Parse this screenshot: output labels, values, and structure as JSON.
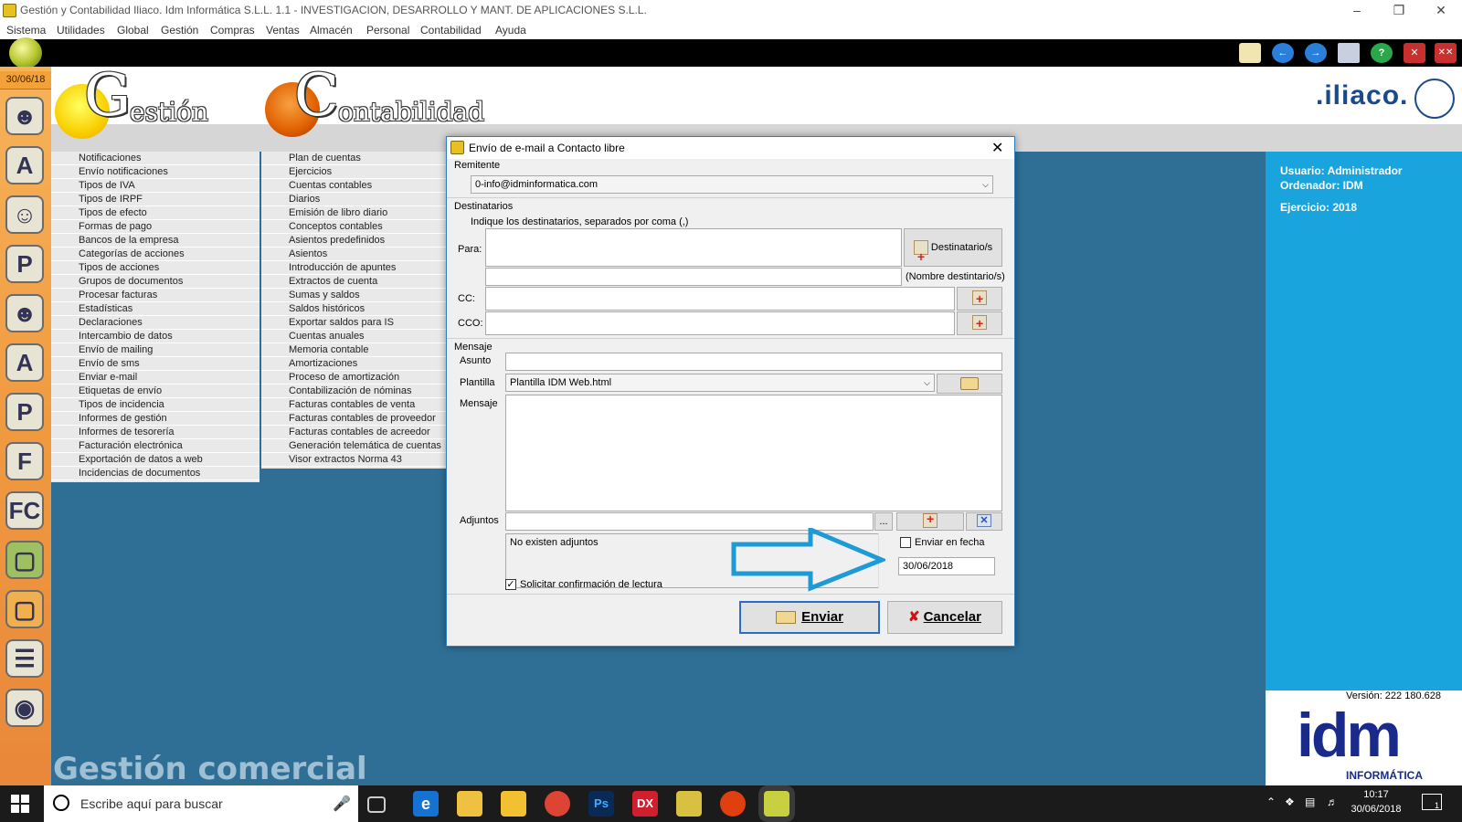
{
  "window": {
    "title": "Gestión y Contabilidad Iliaco. Idm Informática S.L.L. 1.1 - INVESTIGACION, DESARROLLO Y MANT. DE APLICACIONES S.L.L."
  },
  "menubar": [
    "Sistema",
    "Utilidades",
    "Global",
    "Gestión",
    "Compras",
    "Ventas",
    "Almacén",
    "Personal",
    "Contabilidad",
    "Ayuda"
  ],
  "date_badge": "30/06/18",
  "logos": {
    "gestion_letter": "G",
    "gestion_rest": "estión",
    "contabilidad_letter": "C",
    "contabilidad_rest": "ontabilidad",
    "iliaco": ".iliaco.",
    "idm": "idm",
    "idm_sub": "INFORMÁTICA"
  },
  "gestion_menu": [
    "Notificaciones",
    "Envío notificaciones",
    "Tipos de IVA",
    "Tipos de IRPF",
    "Tipos de efecto",
    "Formas de pago",
    "Bancos de la empresa",
    "Categorías de acciones",
    "Tipos de acciones",
    "Grupos de documentos",
    "Procesar facturas",
    "Estadísticas",
    "Declaraciones",
    "Intercambio de datos",
    "Envío de mailing",
    "Envío de sms",
    "Enviar e-mail",
    "Etiquetas de envío",
    "Tipos de incidencia",
    "Informes de gestión",
    "Informes de tesorería",
    "Facturación electrónica",
    "Exportación de datos a web",
    "Incidencias de documentos"
  ],
  "contabilidad_menu": [
    "Plan de cuentas",
    "Ejercicios",
    "Cuentas contables",
    "Diarios",
    "Emisión de libro diario",
    "Conceptos contables",
    "Asientos predefinidos",
    "Asientos",
    "Introducción de apuntes",
    "Extractos de cuenta",
    "Sumas y saldos",
    "Saldos históricos",
    "Exportar saldos para IS",
    "Cuentas anuales",
    "Memoria contable",
    "Amortizaciones",
    "Proceso de amortización",
    "Contabilización de nóminas",
    "Facturas contables de venta",
    "Facturas contables de proveedor",
    "Facturas contables de acreedor",
    "Generación telemática de cuentas",
    "Visor extractos Norma 43"
  ],
  "footer_label": "Gestión comercial",
  "right_panel": {
    "usuario": "Usuario: Administrador",
    "ordenador": "Ordenador: IDM",
    "ejercicio": "Ejercicio: 2018",
    "version": "Versión: 222 180.628"
  },
  "dialog": {
    "title": "Envío de e-mail a Contacto libre",
    "remitente_label": "Remitente",
    "remitente_value": "0-info@idminformatica.com",
    "destinatarios_label": "Destinatarios",
    "destinatarios_hint": "Indique los destinatarios, separados por coma (,)",
    "para_label": "Para:",
    "destinatario_button": "Destinatario/s",
    "nombre_destinatario": "(Nombre destintario/s)",
    "cc_label": "CC:",
    "cco_label": "CCO:",
    "mensaje_section": "Mensaje",
    "asunto_label": "Asunto",
    "plantilla_label": "Plantilla",
    "plantilla_value": "Plantilla IDM Web.html",
    "mensaje_label": "Mensaje",
    "adjuntos_label": "Adjuntos",
    "browse_label": "...",
    "no_adjuntos": "No existen adjuntos",
    "enviar_en_fecha_label": "Enviar en fecha",
    "enviar_en_fecha_checked": false,
    "fecha_value": "30/06/2018",
    "confirmacion_label": "Solicitar confirmación de lectura",
    "confirmacion_checked": true,
    "send_button": "Enviar",
    "cancel_button": "Cancelar"
  },
  "taskbar": {
    "search_placeholder": "Escribe aquí para buscar",
    "clock_time": "10:17",
    "clock_date": "30/06/2018",
    "notification_count": "1"
  },
  "colors": {
    "desktop_blue": "#2f6f96",
    "panel_blue": "#1aa4de",
    "arrow_blue": "#1e9ad6",
    "left_strip_orange": "#f09a40"
  }
}
